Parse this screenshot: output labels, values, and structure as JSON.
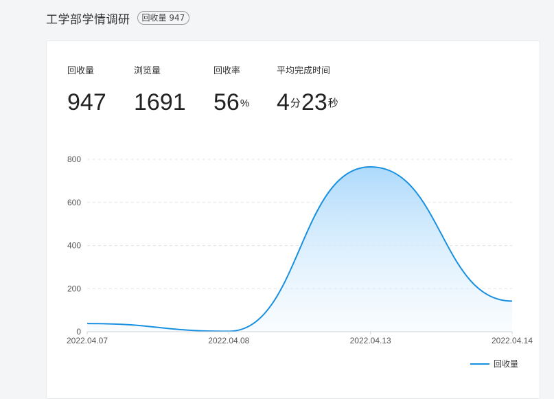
{
  "header": {
    "title": "工学部学情调研",
    "badge": "回收量 947"
  },
  "stats": [
    {
      "label": "回收量",
      "value": "947"
    },
    {
      "label": "浏览量",
      "value": "1691"
    },
    {
      "label": "回收率",
      "value": "56",
      "unit": "%"
    },
    {
      "label": "平均完成时间",
      "minutes": "4",
      "minutes_unit": "分",
      "seconds": "23",
      "seconds_unit": "秒"
    }
  ],
  "chart_data": {
    "type": "area",
    "x": [
      "2022.04.07",
      "2022.04.08",
      "2022.04.13",
      "2022.04.14"
    ],
    "series": [
      {
        "name": "回收量",
        "values": [
          38,
          2,
          765,
          142
        ],
        "color": "#1890e0"
      }
    ],
    "yticks": [
      "0",
      "200",
      "400",
      "600",
      "800"
    ],
    "ylim": [
      0,
      800
    ],
    "grid": true,
    "legend": "bottom-right"
  }
}
